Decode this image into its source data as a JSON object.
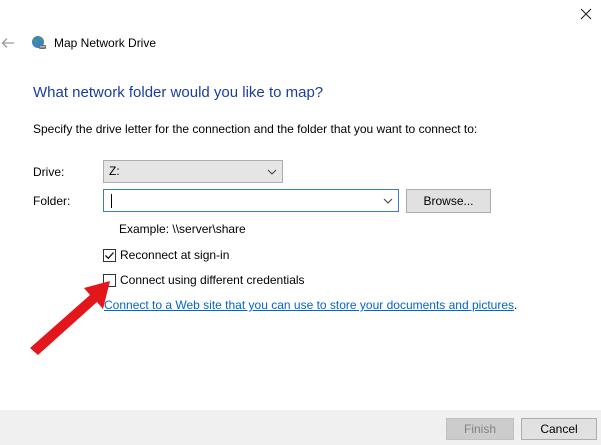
{
  "window": {
    "title": "Map Network Drive",
    "icons": {
      "close": "close-icon",
      "back": "back-arrow-icon",
      "app": "network-drive-icon"
    }
  },
  "main": {
    "heading": "What network folder would you like to map?",
    "instructions": "Specify the drive letter for the connection and the folder that you want to connect to:",
    "drive": {
      "label": "Drive:",
      "value": "Z:"
    },
    "folder": {
      "label": "Folder:",
      "value": ""
    },
    "browse_label": "Browse...",
    "example": "Example: \\\\server\\share",
    "reconnect": {
      "label": "Reconnect at sign-in",
      "checked": true
    },
    "credentials": {
      "label": "Connect using different credentials",
      "checked": false
    },
    "web_link": "Connect to a Web site that you can use to store your documents and pictures",
    "web_link_suffix": "."
  },
  "footer": {
    "finish_label": "Finish",
    "finish_enabled": false,
    "cancel_label": "Cancel"
  },
  "colors": {
    "heading": "#1a3e9a",
    "link": "#0066cc",
    "arrow": "#e3161b",
    "focus_border": "#3b7ad8"
  }
}
